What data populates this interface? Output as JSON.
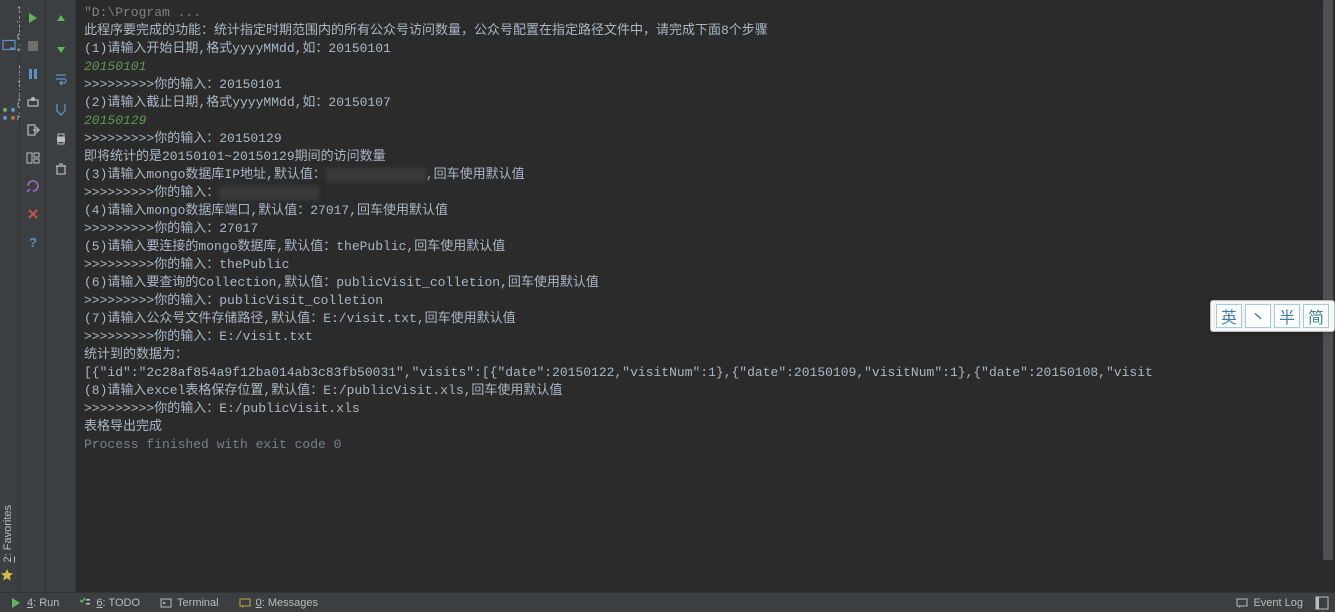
{
  "left_tabs": {
    "project": {
      "num": "1",
      "label": ": Project"
    },
    "structure": {
      "num": "7",
      "label": ": Structure"
    },
    "favorites": {
      "num": "2",
      "label": ": Favorites"
    }
  },
  "console": {
    "l0": "\"D:\\Program ...",
    "l1": "此程序要完成的功能：统计指定时期范围内的所有公众号访问数量，公众号配置在指定路径文件中，请完成下面8个步骤",
    "l2": "(1)请输入开始日期,格式yyyyMMdd,如：20150101",
    "l3": "20150101",
    "l4": ">>>>>>>>>你的输入：20150101",
    "l5": "(2)请输入截止日期,格式yyyyMMdd,如：20150107",
    "l6": "20150129",
    "l7": ">>>>>>>>>你的输入：20150129",
    "l8": "即将统计的是20150101~20150129期间的访问数量",
    "l9a": "(3)请输入mongo数据库IP地址,默认值：",
    "l9b": ",回车使用默认值",
    "l10": "",
    "l11a": ">>>>>>>>>你的输入：",
    "l12": "(4)请输入mongo数据库端口,默认值：27017,回车使用默认值",
    "l13": "",
    "l14": ">>>>>>>>>你的输入：27017",
    "l15": "(5)请输入要连接的mongo数据库,默认值：thePublic,回车使用默认值",
    "l16": "",
    "l17": ">>>>>>>>>你的输入：thePublic",
    "l18": "(6)请输入要查询的Collection,默认值：publicVisit_colletion,回车使用默认值",
    "l19": "",
    "l20": ">>>>>>>>>你的输入：publicVisit_colletion",
    "l21": "(7)请输入公众号文件存储路径,默认值：E:/visit.txt,回车使用默认值",
    "l22": "",
    "l23": ">>>>>>>>>你的输入：E:/visit.txt",
    "l24": "统计到的数据为：",
    "l25": "[{\"id\":\"2c28af854a9f12ba014ab3c83fb50031\",\"visits\":[{\"date\":20150122,\"visitNum\":1},{\"date\":20150109,\"visitNum\":1},{\"date\":20150108,\"visit",
    "l26": "(8)请输入excel表格保存位置,默认值：E:/publicVisit.xls,回车使用默认值",
    "l27": "",
    "l28": ">>>>>>>>>你的输入：E:/publicVisit.xls",
    "l29": "表格导出完成",
    "l30": "",
    "l31": "Process finished with exit code 0"
  },
  "ime": {
    "b1": "英",
    "b2": "丶",
    "b3": "半",
    "b4": "简"
  },
  "bottom": {
    "run": {
      "num": "4",
      "label": ": Run"
    },
    "todo": {
      "num": "6",
      "label": ": TODO"
    },
    "terminal": {
      "label": "Terminal"
    },
    "messages": {
      "num": "0",
      "label": ": Messages"
    },
    "eventlog": "Event Log"
  }
}
